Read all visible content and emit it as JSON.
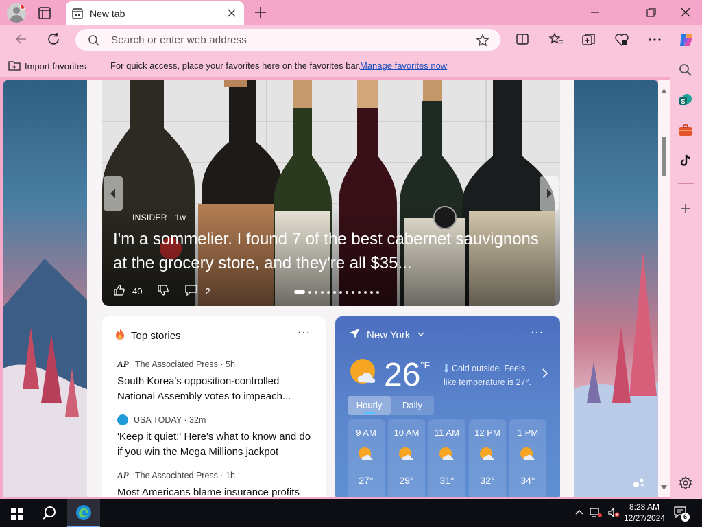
{
  "browser": {
    "tab_title": "New tab",
    "address_placeholder": "Search or enter web address"
  },
  "favorites_bar": {
    "import_label": "Import favorites",
    "hint": "For quick access, place your favorites here on the favorites bar.",
    "manage_link": "Manage favorites now"
  },
  "hero": {
    "source": "INSIDER · 1w",
    "headline": "I'm a sommelier. I found 7 of the best cabernet sauvignons at the grocery store, and they're all $35...",
    "likes": "40",
    "comments": "2",
    "slide_count": 13,
    "active_slide": 1
  },
  "top_stories": {
    "header": "Top stories",
    "more": "···",
    "items": [
      {
        "source": "The Associated Press · 5h",
        "logo": "AP",
        "title": "South Korea's opposition-controlled National Assembly votes to impeach..."
      },
      {
        "source": "USA TODAY · 32m",
        "logo": "",
        "title": "'Keep it quiet:' Here's what to know and do if you win the Mega Millions jackpot"
      },
      {
        "source": "The Associated Press · 1h",
        "logo": "AP",
        "title": "Most Americans blame insurance profits"
      }
    ]
  },
  "weather": {
    "location": "New York",
    "more": "···",
    "temp": "26",
    "unit": "°F",
    "summary": "Cold outside. Feels like temperature is 27°.",
    "tabs": [
      "Hourly",
      "Daily"
    ],
    "selected_tab": "Hourly",
    "hours": [
      {
        "time": "9 AM",
        "temp": "27°"
      },
      {
        "time": "10 AM",
        "temp": "29°"
      },
      {
        "time": "11 AM",
        "temp": "31°"
      },
      {
        "time": "12 PM",
        "temp": "32°"
      },
      {
        "time": "1 PM",
        "temp": "34°"
      }
    ]
  },
  "taskbar": {
    "time": "8:28 AM",
    "date": "12/27/2024",
    "notification_count": "6"
  },
  "colors": {
    "accent_pink": "#f4a7c8",
    "toolbar_pink": "#f9c6dc",
    "link_blue": "#1a4fc0",
    "weather_blue": "#5a85cc"
  }
}
